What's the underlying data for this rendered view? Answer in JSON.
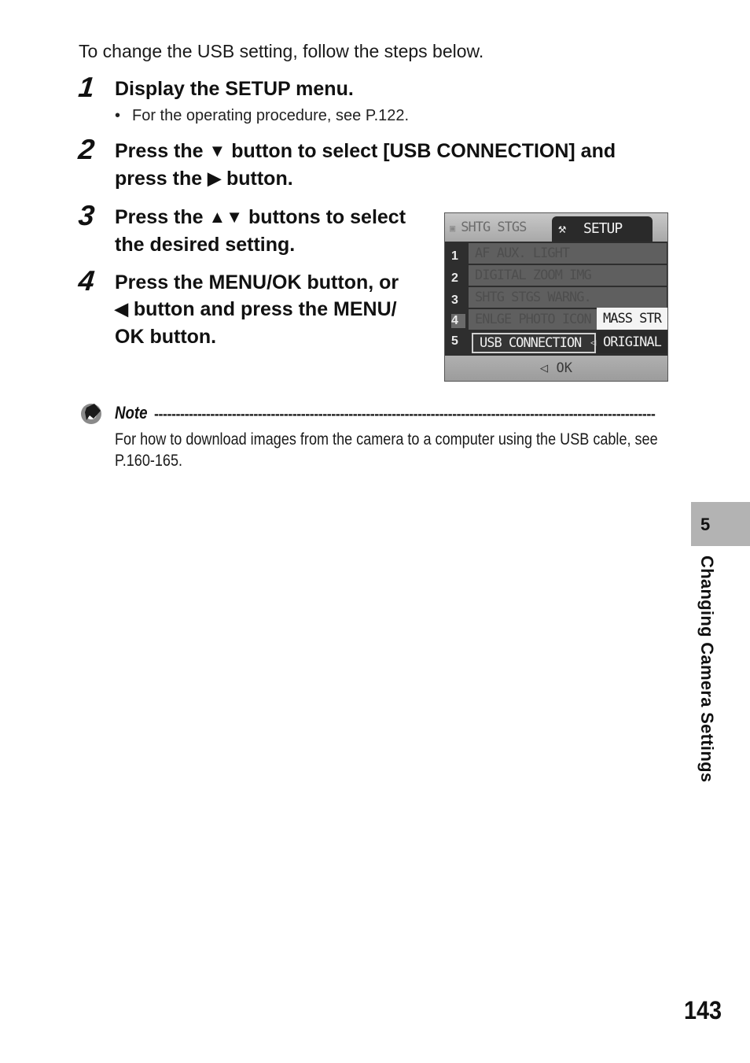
{
  "intro": "To change the USB setting, follow the steps below.",
  "steps": [
    {
      "number": "1",
      "lines": [
        "Display the SETUP menu."
      ],
      "sub": "For the operating procedure, see P.122."
    },
    {
      "number": "2",
      "line1_a": "Press the ",
      "line1_glyph": "▼",
      "line1_b": " button to select [USB CONNECTION] and",
      "line2_a": "press the ",
      "line2_glyph": "▶",
      "line2_b": " button."
    },
    {
      "number": "3",
      "line1_a": "Press the ",
      "line1_glyph": "▲▼",
      "line1_b": " buttons to select",
      "line2": "the desired setting."
    },
    {
      "number": "4",
      "line1": "Press the MENU/OK button, or",
      "line2_glyph": "◀",
      "line2_b": " button and press the MENU/",
      "line3": "OK button."
    }
  ],
  "bullet": "•",
  "camera_screen": {
    "tabs": {
      "inactive_icon": "camera-icon",
      "inactive_icon_glyph": "▣",
      "inactive_label": "SHTG STGS",
      "active_icon": "wrench-icon",
      "active_icon_glyph": "⚒",
      "active_label": "SETUP"
    },
    "rows": [
      {
        "num": "1",
        "label": "AF AUX. LIGHT"
      },
      {
        "num": "2",
        "label": "DIGITAL ZOOM IMG"
      },
      {
        "num": "3",
        "label": "SHTG STGS WARNG."
      },
      {
        "num": "4",
        "label": "ENLGE PHOTO ICON"
      },
      {
        "num": "5",
        "label": "USB CONNECTION",
        "selected": true
      }
    ],
    "options": [
      {
        "label": "MASS STR",
        "highlighted": true
      },
      {
        "label": "ORIGINAL",
        "highlighted": false
      }
    ],
    "option_arrow": "◁",
    "footer": "◁ OK"
  },
  "note": {
    "icon": "note-pencil-icon",
    "title": "Note",
    "dashes": "--------------------------------------------------------------------------------------------------------------------",
    "body_line1": "For how to download images from the camera to a computer using the USB cable, see",
    "body_line2": "P.160-165."
  },
  "side_tab": {
    "chapter_number": "5",
    "chapter_title": "Changing Camera Settings",
    "color": "#b3b3b3"
  },
  "page_number": "143"
}
